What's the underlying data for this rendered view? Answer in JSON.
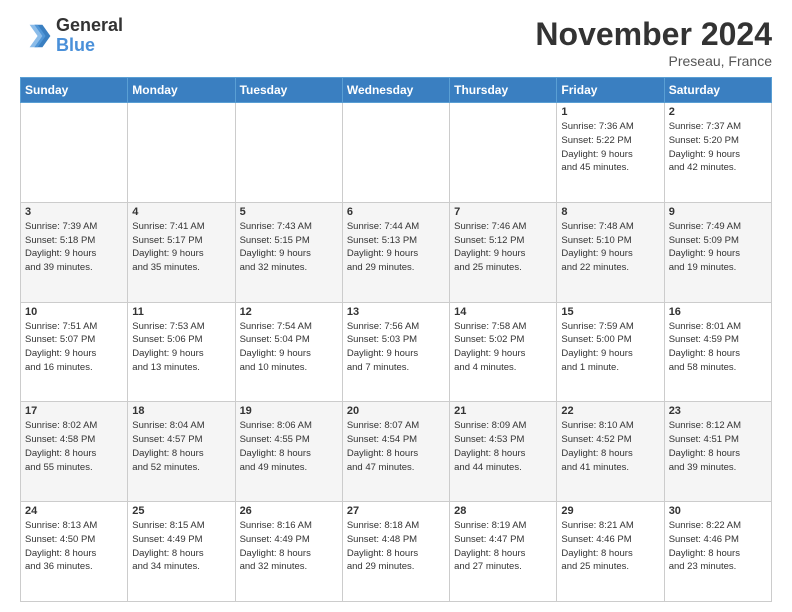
{
  "header": {
    "logo_line1": "General",
    "logo_line2": "Blue",
    "month_title": "November 2024",
    "location": "Preseau, France"
  },
  "weekdays": [
    "Sunday",
    "Monday",
    "Tuesday",
    "Wednesday",
    "Thursday",
    "Friday",
    "Saturday"
  ],
  "weeks": [
    [
      {
        "day": "",
        "info": ""
      },
      {
        "day": "",
        "info": ""
      },
      {
        "day": "",
        "info": ""
      },
      {
        "day": "",
        "info": ""
      },
      {
        "day": "",
        "info": ""
      },
      {
        "day": "1",
        "info": "Sunrise: 7:36 AM\nSunset: 5:22 PM\nDaylight: 9 hours\nand 45 minutes."
      },
      {
        "day": "2",
        "info": "Sunrise: 7:37 AM\nSunset: 5:20 PM\nDaylight: 9 hours\nand 42 minutes."
      }
    ],
    [
      {
        "day": "3",
        "info": "Sunrise: 7:39 AM\nSunset: 5:18 PM\nDaylight: 9 hours\nand 39 minutes."
      },
      {
        "day": "4",
        "info": "Sunrise: 7:41 AM\nSunset: 5:17 PM\nDaylight: 9 hours\nand 35 minutes."
      },
      {
        "day": "5",
        "info": "Sunrise: 7:43 AM\nSunset: 5:15 PM\nDaylight: 9 hours\nand 32 minutes."
      },
      {
        "day": "6",
        "info": "Sunrise: 7:44 AM\nSunset: 5:13 PM\nDaylight: 9 hours\nand 29 minutes."
      },
      {
        "day": "7",
        "info": "Sunrise: 7:46 AM\nSunset: 5:12 PM\nDaylight: 9 hours\nand 25 minutes."
      },
      {
        "day": "8",
        "info": "Sunrise: 7:48 AM\nSunset: 5:10 PM\nDaylight: 9 hours\nand 22 minutes."
      },
      {
        "day": "9",
        "info": "Sunrise: 7:49 AM\nSunset: 5:09 PM\nDaylight: 9 hours\nand 19 minutes."
      }
    ],
    [
      {
        "day": "10",
        "info": "Sunrise: 7:51 AM\nSunset: 5:07 PM\nDaylight: 9 hours\nand 16 minutes."
      },
      {
        "day": "11",
        "info": "Sunrise: 7:53 AM\nSunset: 5:06 PM\nDaylight: 9 hours\nand 13 minutes."
      },
      {
        "day": "12",
        "info": "Sunrise: 7:54 AM\nSunset: 5:04 PM\nDaylight: 9 hours\nand 10 minutes."
      },
      {
        "day": "13",
        "info": "Sunrise: 7:56 AM\nSunset: 5:03 PM\nDaylight: 9 hours\nand 7 minutes."
      },
      {
        "day": "14",
        "info": "Sunrise: 7:58 AM\nSunset: 5:02 PM\nDaylight: 9 hours\nand 4 minutes."
      },
      {
        "day": "15",
        "info": "Sunrise: 7:59 AM\nSunset: 5:00 PM\nDaylight: 9 hours\nand 1 minute."
      },
      {
        "day": "16",
        "info": "Sunrise: 8:01 AM\nSunset: 4:59 PM\nDaylight: 8 hours\nand 58 minutes."
      }
    ],
    [
      {
        "day": "17",
        "info": "Sunrise: 8:02 AM\nSunset: 4:58 PM\nDaylight: 8 hours\nand 55 minutes."
      },
      {
        "day": "18",
        "info": "Sunrise: 8:04 AM\nSunset: 4:57 PM\nDaylight: 8 hours\nand 52 minutes."
      },
      {
        "day": "19",
        "info": "Sunrise: 8:06 AM\nSunset: 4:55 PM\nDaylight: 8 hours\nand 49 minutes."
      },
      {
        "day": "20",
        "info": "Sunrise: 8:07 AM\nSunset: 4:54 PM\nDaylight: 8 hours\nand 47 minutes."
      },
      {
        "day": "21",
        "info": "Sunrise: 8:09 AM\nSunset: 4:53 PM\nDaylight: 8 hours\nand 44 minutes."
      },
      {
        "day": "22",
        "info": "Sunrise: 8:10 AM\nSunset: 4:52 PM\nDaylight: 8 hours\nand 41 minutes."
      },
      {
        "day": "23",
        "info": "Sunrise: 8:12 AM\nSunset: 4:51 PM\nDaylight: 8 hours\nand 39 minutes."
      }
    ],
    [
      {
        "day": "24",
        "info": "Sunrise: 8:13 AM\nSunset: 4:50 PM\nDaylight: 8 hours\nand 36 minutes."
      },
      {
        "day": "25",
        "info": "Sunrise: 8:15 AM\nSunset: 4:49 PM\nDaylight: 8 hours\nand 34 minutes."
      },
      {
        "day": "26",
        "info": "Sunrise: 8:16 AM\nSunset: 4:49 PM\nDaylight: 8 hours\nand 32 minutes."
      },
      {
        "day": "27",
        "info": "Sunrise: 8:18 AM\nSunset: 4:48 PM\nDaylight: 8 hours\nand 29 minutes."
      },
      {
        "day": "28",
        "info": "Sunrise: 8:19 AM\nSunset: 4:47 PM\nDaylight: 8 hours\nand 27 minutes."
      },
      {
        "day": "29",
        "info": "Sunrise: 8:21 AM\nSunset: 4:46 PM\nDaylight: 8 hours\nand 25 minutes."
      },
      {
        "day": "30",
        "info": "Sunrise: 8:22 AM\nSunset: 4:46 PM\nDaylight: 8 hours\nand 23 minutes."
      }
    ]
  ]
}
